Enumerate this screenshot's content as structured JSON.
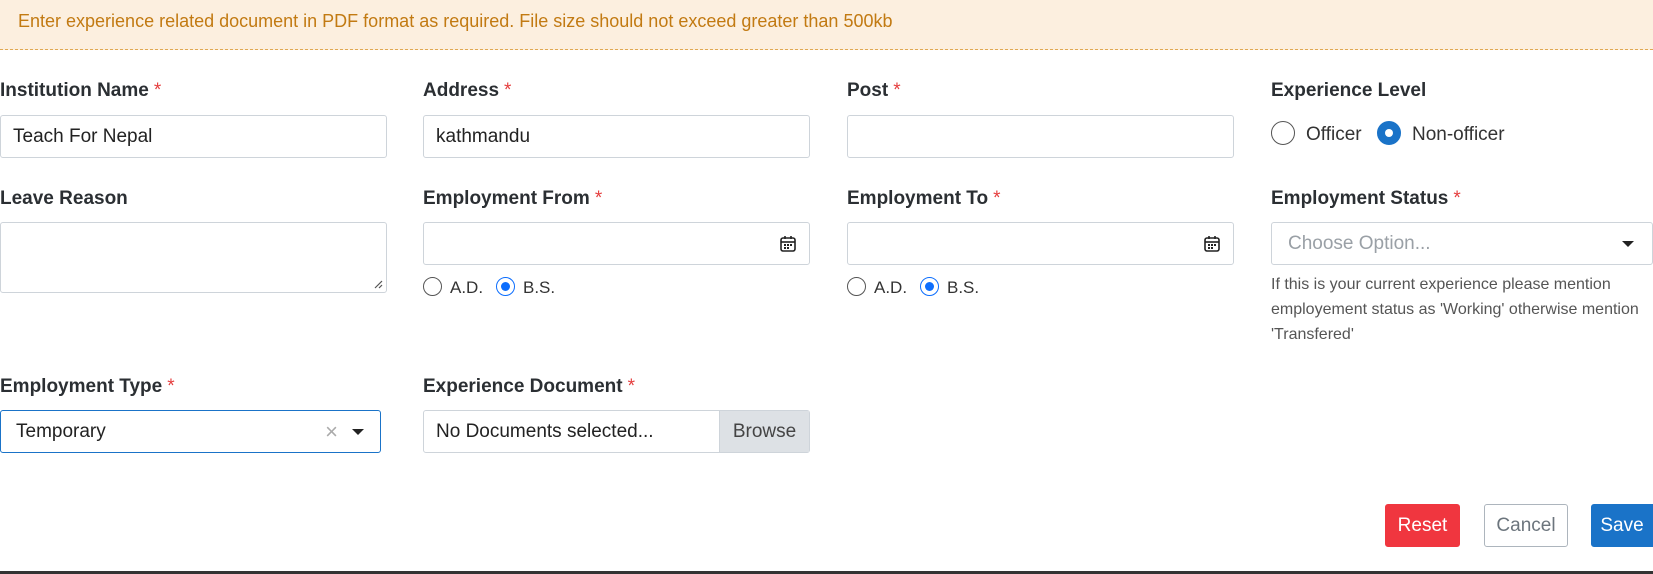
{
  "notice": "Enter experience related document in PDF format as required. File size should not exceed greater than 500kb",
  "fields": {
    "institution": {
      "label": "Institution Name",
      "value": "Teach For Nepal"
    },
    "address": {
      "label": "Address",
      "value": "kathmandu"
    },
    "post": {
      "label": "Post",
      "value": ""
    },
    "experience_level": {
      "label": "Experience Level",
      "options": [
        "Officer",
        "Non-officer"
      ],
      "selected": "Non-officer"
    },
    "leave_reason": {
      "label": "Leave Reason",
      "value": ""
    },
    "employment_from": {
      "label": "Employment From",
      "value": "",
      "calendar_options": [
        "A.D.",
        "B.S."
      ],
      "selected": "B.S."
    },
    "employment_to": {
      "label": "Employment To",
      "value": "",
      "calendar_options": [
        "A.D.",
        "B.S."
      ],
      "selected": "B.S."
    },
    "employment_status": {
      "label": "Employment Status",
      "placeholder": "Choose Option...",
      "help": "If this is your current experience please mention employement status as 'Working' otherwise mention 'Transfered'"
    },
    "employment_type": {
      "label": "Employment Type",
      "value": "Temporary",
      "clear": "×"
    },
    "experience_document": {
      "label": "Experience Document",
      "value": "No Documents selected...",
      "browse": "Browse"
    }
  },
  "required_mark": "*",
  "buttons": {
    "reset": "Reset",
    "cancel": "Cancel",
    "save": "Save"
  },
  "colors": {
    "accent": "#1a73c8",
    "danger": "#f0363f",
    "notice_bg": "#fcefdf",
    "notice_text": "#c27a12"
  }
}
